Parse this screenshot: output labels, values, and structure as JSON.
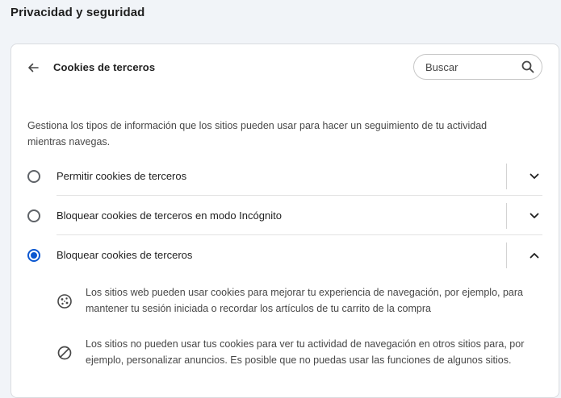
{
  "section": {
    "title": "Privacidad y seguridad"
  },
  "header": {
    "back_icon": "arrow-back-icon",
    "title": "Cookies de terceros",
    "search_placeholder": "Buscar",
    "search_value": "",
    "search_icon": "search-icon"
  },
  "description": "Gestiona los tipos de información que los sitios pueden usar para hacer un seguimiento de tu actividad mientras navegas.",
  "options": [
    {
      "label": "Permitir cookies de terceros",
      "selected": false,
      "expanded": false,
      "chevron_icon": "chevron-down-icon"
    },
    {
      "label": "Bloquear cookies de terceros en modo Incógnito",
      "selected": false,
      "expanded": false,
      "chevron_icon": "chevron-down-icon"
    },
    {
      "label": "Bloquear cookies de terceros",
      "selected": true,
      "expanded": true,
      "chevron_icon": "chevron-up-icon"
    }
  ],
  "details": [
    {
      "icon": "cookie-icon",
      "text": "Los sitios web pueden usar cookies para mejorar tu experiencia de navegación, por ejemplo, para mantener tu sesión iniciada o recordar los artículos de tu carrito de la compra"
    },
    {
      "icon": "block-icon",
      "text": "Los sitios no pueden usar tus cookies para ver tu actividad de navegación en otros sitios para, por ejemplo, personalizar anuncios. Es posible que no puedas usar las funciones de algunos sitios."
    }
  ],
  "colors": {
    "page_bg": "#f1f4f8",
    "card_bg": "#ffffff",
    "accent": "#0b57d0",
    "text_primary": "#1f1f1f",
    "text_secondary": "#474747"
  }
}
